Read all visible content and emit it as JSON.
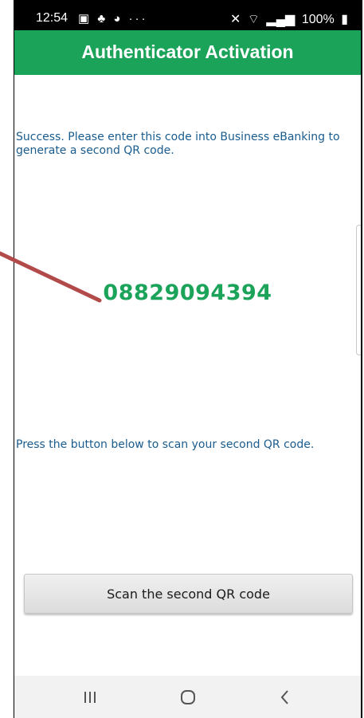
{
  "status_bar": {
    "time": "12:54",
    "left_icons": [
      "image-icon",
      "notification-icon",
      "app-icon",
      "more-icon"
    ],
    "more_glyph": "···",
    "battery": "100%",
    "right_icons": [
      "mute-icon",
      "wifi-icon",
      "signal-icon",
      "battery-icon"
    ]
  },
  "app_bar": {
    "title": "Authenticator Activation"
  },
  "content": {
    "success_message": "Success. Please enter this code into Business eBanking to generate a second QR code.",
    "activation_code": "08829094394",
    "instruction": "Press the button below to scan your second QR code.",
    "scan_button_label": "Scan the second QR code"
  },
  "nav_bar": {
    "buttons": [
      "recents-icon",
      "home-icon",
      "back-icon"
    ]
  },
  "colors": {
    "accent": "#1ca35a",
    "text_blue": "#1a5c8e",
    "arrow": "#b34a4a"
  }
}
